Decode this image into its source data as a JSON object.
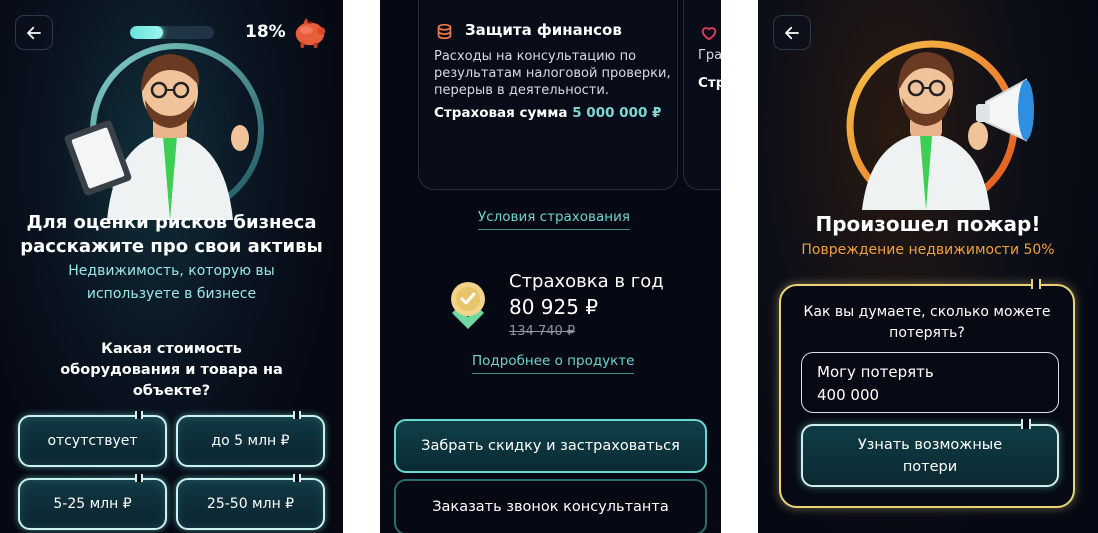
{
  "screen1": {
    "progress_percent": 18,
    "progress_label": "18%",
    "title_line1": "Для оценки рисков бизнеса",
    "title_line2": "расскажите про свои активы",
    "subtitle_line1": "Недвижимость, которую вы",
    "subtitle_line2": "используете в бизнесе",
    "question_line1": "Какая стоимость",
    "question_line2": "оборудования и товара на",
    "question_line3": "объекте?",
    "options": [
      "отсутствует",
      "до 5 млн ₽",
      "5-25 млн ₽",
      "25-50 млн ₽"
    ],
    "icons": {
      "back": "arrow-left-icon",
      "piggy": "piggy-bank-icon"
    }
  },
  "screen2": {
    "card1": {
      "title": "Защита финансов",
      "text_line1": "Расходы на консультацию по",
      "text_line2": "результатам налоговой проверки,",
      "text_line3": "перерыв в деятельности.",
      "sum_label": "Страховая сумма",
      "sum_value": "5 000 000 ₽"
    },
    "card2": {
      "title_partial": "Грах",
      "text_partial": "Стр"
    },
    "terms_link": "Условия страхования",
    "price_label": "Страховка в год",
    "price": "80 925 ₽",
    "price_old": "134 740 ₽",
    "details_link": "Подробнее о продукте",
    "primary_button": "Забрать скидку и застраховаться",
    "secondary_button": "Заказать звонок консультанта",
    "accent": "#6fd2cc"
  },
  "screen3": {
    "title": "Произошел пожар!",
    "subtitle": "Повреждение недвижимости 50%",
    "question_line1": "Как вы думаете, сколько можете",
    "question_line2": "потерять?",
    "loss_label": "Могу потерять",
    "loss_value": "400 000",
    "button_line1": "Узнать возможные",
    "button_line2": "потери",
    "accent": "#f0a03c"
  }
}
